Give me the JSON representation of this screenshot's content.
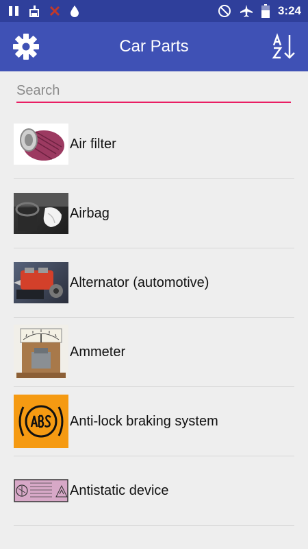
{
  "status_bar": {
    "time": "3:24",
    "left_icons": [
      "pause-icon",
      "cleaner-icon",
      "close-red-icon",
      "water-drop-icon"
    ],
    "right_icons": [
      "do-not-disturb-icon",
      "airplane-icon",
      "battery-icon"
    ]
  },
  "app_bar": {
    "title": "Car Parts",
    "settings_icon": "gear-icon",
    "sort_icon": "sort-az-icon"
  },
  "search": {
    "placeholder": "Search",
    "value": "",
    "underline_color": "#e91e63"
  },
  "colors": {
    "status_bar": "#2f3f9b",
    "app_bar": "#3f51b5",
    "background": "#eeeeee"
  },
  "items": [
    {
      "label": "Air filter"
    },
    {
      "label": "Airbag"
    },
    {
      "label": "Alternator (automotive)"
    },
    {
      "label": "Ammeter"
    },
    {
      "label": "Anti-lock braking system"
    },
    {
      "label": "Antistatic device"
    }
  ]
}
